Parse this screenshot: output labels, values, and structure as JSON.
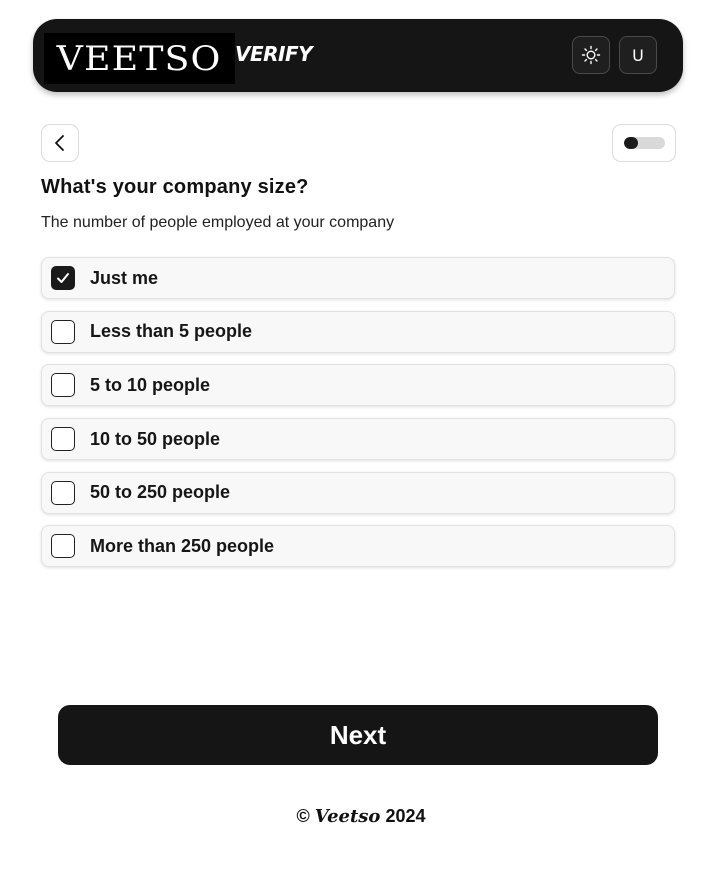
{
  "header": {
    "logo_text": "VEETSO",
    "logo_suffix": "VERIFY",
    "theme_icon": "sun-icon",
    "user_initial": "U"
  },
  "progress": {
    "fraction": 0.35
  },
  "question": {
    "title": "What's your company size?",
    "subtitle": "The number of people employed at your company"
  },
  "options": [
    {
      "label": "Just me",
      "checked": true
    },
    {
      "label": "Less than 5 people",
      "checked": false
    },
    {
      "label": "5 to 10 people",
      "checked": false
    },
    {
      "label": "10 to 50 people",
      "checked": false
    },
    {
      "label": "50 to 250 people",
      "checked": false
    },
    {
      "label": "More than 250 people",
      "checked": false
    }
  ],
  "next_label": "Next",
  "footer": {
    "symbol": "©",
    "brand": "Veetso",
    "year": "2024"
  }
}
